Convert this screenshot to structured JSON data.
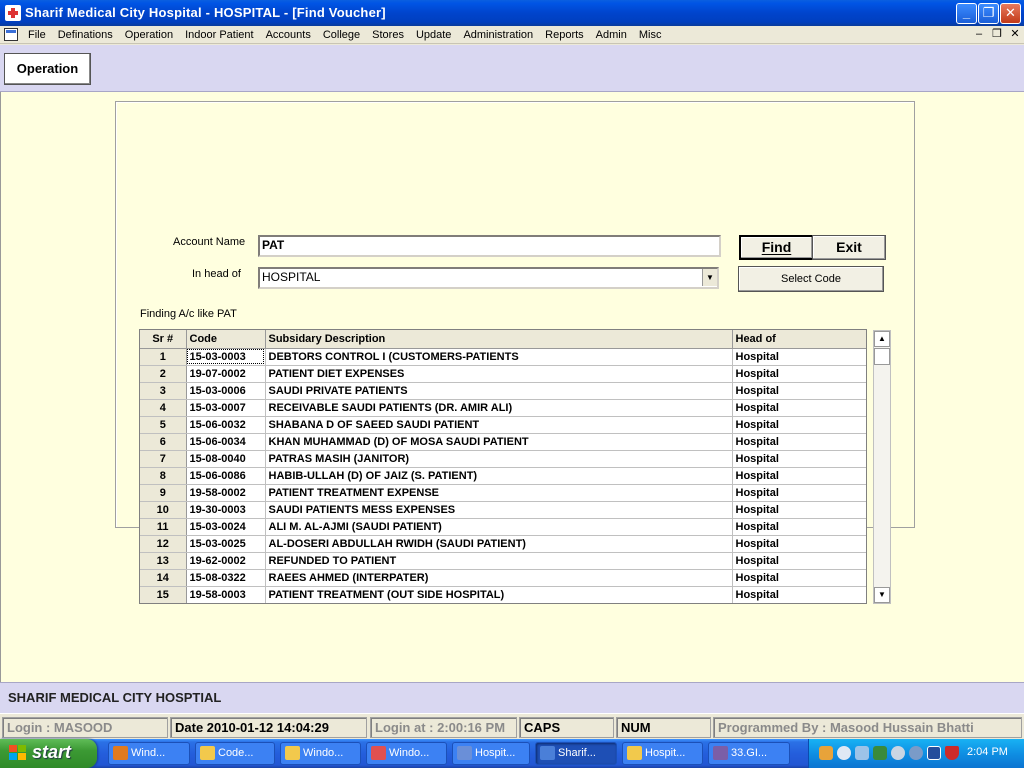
{
  "window": {
    "title": "Sharif Medical City Hospital - HOSPITAL - [Find Voucher]"
  },
  "menu": [
    "File",
    "Definations",
    "Operation",
    "Indoor Patient",
    "Accounts",
    "College",
    "Stores",
    "Update",
    "Administration",
    "Reports",
    "Admin",
    "Misc"
  ],
  "toolbar": {
    "operation_label": "Operation"
  },
  "form": {
    "account_name_label": "Account Name",
    "account_name_value": "PAT",
    "head_label": "In head of",
    "head_value": "HOSPITAL",
    "find_label": "Find",
    "exit_label": "Exit",
    "select_code_label": "Select Code",
    "finding_text": "Finding A/c like PAT"
  },
  "grid": {
    "headers": [
      "Sr #",
      "Code",
      "Subsidary Description",
      "Head of"
    ],
    "rows": [
      [
        "1",
        "15-03-0003",
        "DEBTORS CONTROL I (CUSTOMERS-PATIENTS",
        "Hospital"
      ],
      [
        "2",
        "19-07-0002",
        "PATIENT DIET EXPENSES",
        "Hospital"
      ],
      [
        "3",
        "15-03-0006",
        "SAUDI PRIVATE PATIENTS",
        "Hospital"
      ],
      [
        "4",
        "15-03-0007",
        "RECEIVABLE SAUDI PATIENTS (DR. AMIR ALI)",
        "Hospital"
      ],
      [
        "5",
        "15-06-0032",
        "SHABANA D OF SAEED SAUDI PATIENT",
        "Hospital"
      ],
      [
        "6",
        "15-06-0034",
        "KHAN MUHAMMAD (D) OF MOSA SAUDI PATIENT",
        "Hospital"
      ],
      [
        "7",
        "15-08-0040",
        "PATRAS MASIH (JANITOR)",
        "Hospital"
      ],
      [
        "8",
        "15-06-0086",
        "HABIB-ULLAH (D) OF JAIZ (S. PATIENT)",
        "Hospital"
      ],
      [
        "9",
        "19-58-0002",
        "PATIENT TREATMENT EXPENSE",
        "Hospital"
      ],
      [
        "10",
        "19-30-0003",
        "SAUDI PATIENTS MESS EXPENSES",
        "Hospital"
      ],
      [
        "11",
        "15-03-0024",
        "ALI M. AL-AJMI (SAUDI PATIENT)",
        "Hospital"
      ],
      [
        "12",
        "15-03-0025",
        "AL-DOSERI ABDULLAH RWIDH (SAUDI PATIENT)",
        "Hospital"
      ],
      [
        "13",
        "19-62-0002",
        "REFUNDED TO PATIENT",
        "Hospital"
      ],
      [
        "14",
        "15-08-0322",
        "RAEES AHMED (INTERPATER)",
        "Hospital"
      ],
      [
        "15",
        "19-58-0003",
        "PATIENT TREATMENT (OUT SIDE HOSPITAL)",
        "Hospital"
      ]
    ]
  },
  "banner": {
    "text": "SHARIF MEDICAL CITY HOSPTIAL"
  },
  "statusbar": {
    "login": "Login :  MASOOD",
    "date": "Date 2010-01-12 14:04:29",
    "login_at": "Login at : 2:00:16 PM",
    "caps": "CAPS",
    "num": "NUM",
    "programmer": "Programmed By : Masood Hussain Bhatti"
  },
  "taskbar": {
    "start_label": "start",
    "tasks": [
      "Wind...",
      "Code...",
      "Windo...",
      "Windo...",
      "Hospit...",
      "Sharif...",
      "Hospit...",
      "33.GI..."
    ],
    "clock": "2:04 PM"
  },
  "colors": {
    "main_bg": "#FFFFDF",
    "toolbar_bg": "#D9D7F1",
    "title_blue": "#0044CC"
  }
}
